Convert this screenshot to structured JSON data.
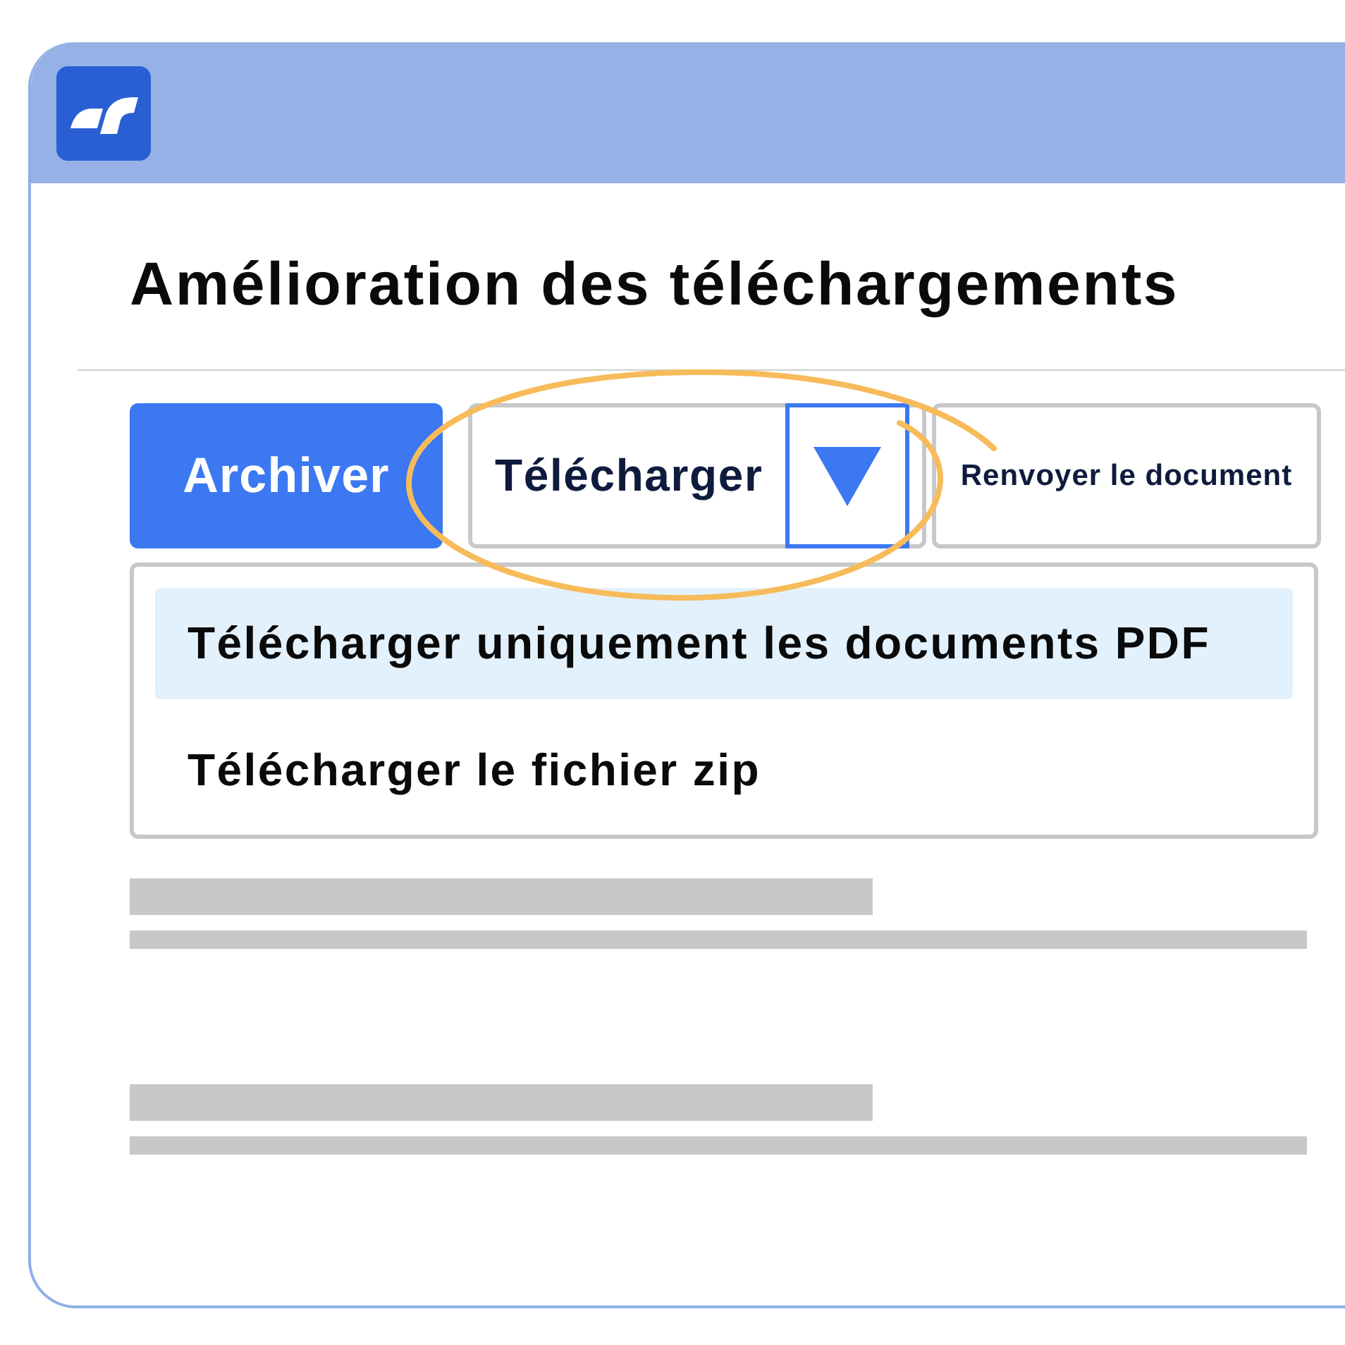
{
  "page_title": "Amélioration des téléchargements",
  "toolbar": {
    "buttons": [
      {
        "kind": "primary",
        "label": "Archiver"
      },
      {
        "kind": "split",
        "label": "Télécharger",
        "expanded": true,
        "circled": true,
        "menu": {
          "items": [
            {
              "label": "Télécharger uniquement les documents PDF",
              "selected": true
            },
            {
              "label": "Télécharger le fichier zip",
              "selected": false
            }
          ]
        }
      },
      {
        "kind": "outline",
        "label": "Renvoyer le document"
      }
    ]
  }
}
